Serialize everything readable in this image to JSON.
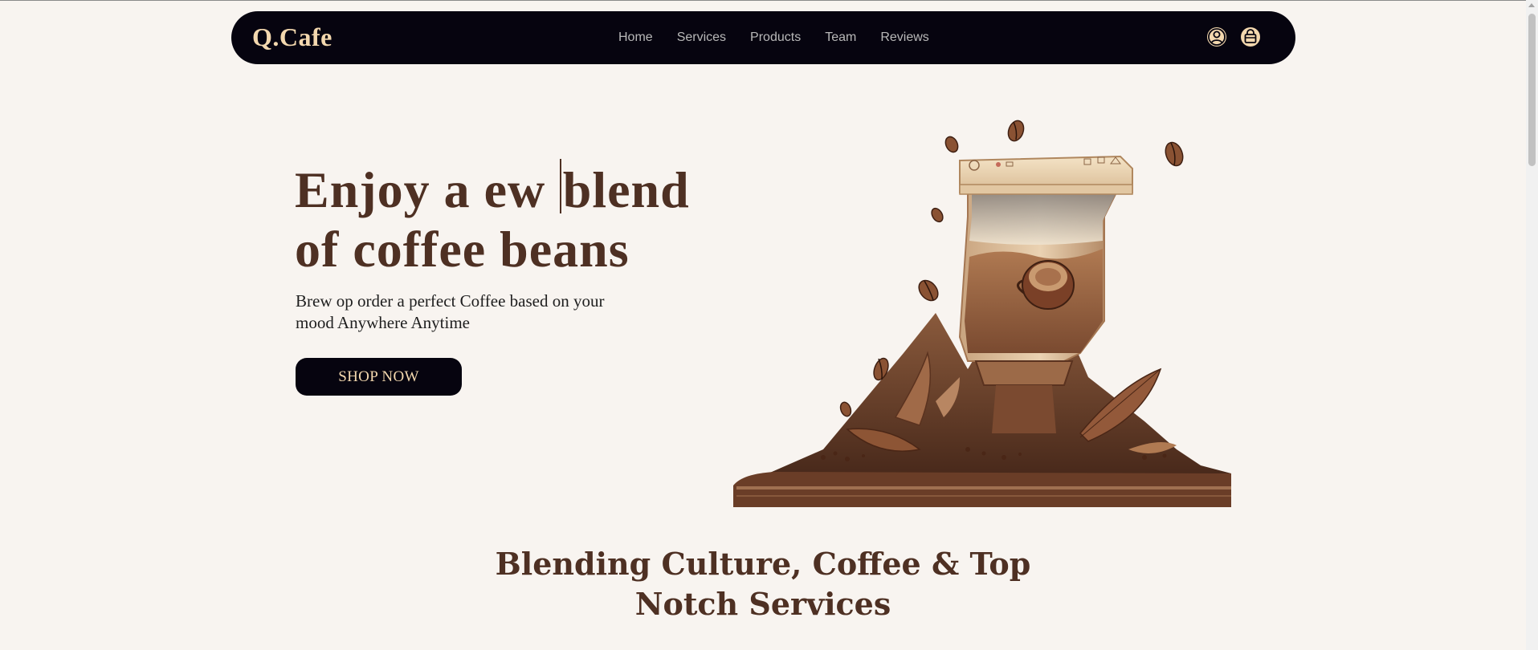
{
  "brand": {
    "logo": "Q.Cafe"
  },
  "nav": {
    "links": [
      "Home",
      "Services",
      "Products",
      "Team",
      "Reviews"
    ],
    "icons": [
      "user-icon",
      "shopping-bag-icon"
    ]
  },
  "hero": {
    "title_line1_a": "Enjoy a ew ",
    "title_line1_b": "blend",
    "title_line2": "of coffee beans",
    "subtitle": "Brew op order a perfect Coffee based on your mood Anywhere Anytime",
    "cta_label": "SHOP NOW",
    "image": "coffee-grinder-illustration"
  },
  "section": {
    "title_line1": "Blending Culture, Coffee & Top",
    "title_line2": "Notch Services"
  },
  "colors": {
    "nav_bg": "#06040f",
    "brand_accent": "#f3d8ae",
    "heading": "#4e3023",
    "page_bg": "#f8f4f0"
  }
}
